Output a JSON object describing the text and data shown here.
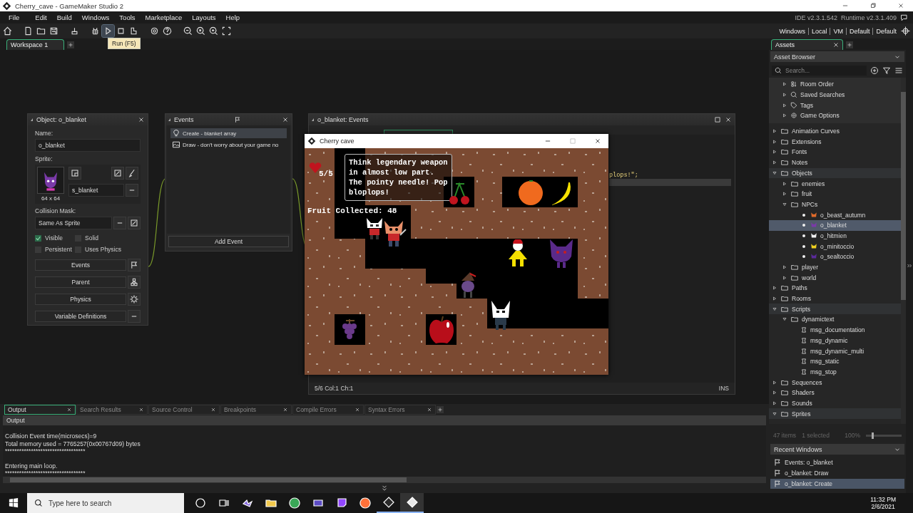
{
  "window": {
    "title": "Cherry_cave - GameMaker Studio 2"
  },
  "menu": [
    "File",
    "Edit",
    "Build",
    "Windows",
    "Tools",
    "Marketplace",
    "Layouts",
    "Help"
  ],
  "ide_version": "IDE v2.3.1.542",
  "runtime_version": "Runtime v2.3.1.409",
  "toolbar": {
    "groups": [
      [
        {
          "kind": "home",
          "active": false
        }
      ],
      [
        {
          "kind": "new",
          "active": false
        },
        {
          "kind": "open",
          "active": false
        },
        {
          "kind": "save",
          "active": false
        }
      ],
      [
        {
          "kind": "clean",
          "active": false
        }
      ],
      [
        {
          "kind": "debug",
          "active": false
        },
        {
          "kind": "run",
          "active": true
        },
        {
          "kind": "stop",
          "active": false
        },
        {
          "kind": "build",
          "active": false
        }
      ],
      [
        {
          "kind": "settings",
          "active": false
        },
        {
          "kind": "help",
          "active": false
        }
      ],
      [
        {
          "kind": "zoomout",
          "active": false
        },
        {
          "kind": "zoomreset",
          "active": false
        },
        {
          "kind": "zoomin",
          "active": false
        },
        {
          "kind": "fullscreen",
          "active": false
        }
      ]
    ],
    "tooltip": "Run (F5)",
    "targets": [
      "Windows",
      "Local",
      "VM",
      "Default",
      "Default"
    ]
  },
  "workspace_tabs": [
    {
      "label": "Workspace 1",
      "selected": true
    }
  ],
  "object_window": {
    "title": "Object: o_blanket",
    "name_label": "Name:",
    "name": "o_blanket",
    "sprite_label": "Sprite:",
    "sprite_size": "64 x 64",
    "sprite": "s_blanket",
    "mask_label": "Collision Mask:",
    "mask": "Same As Sprite",
    "options": [
      {
        "label": "Visible",
        "checked": true
      },
      {
        "label": "Solid",
        "checked": false
      },
      {
        "label": "Persistent",
        "checked": false
      },
      {
        "label": "Uses Physics",
        "checked": false
      }
    ],
    "buttons": [
      {
        "label": "Events",
        "kind": "flag"
      },
      {
        "label": "Parent",
        "kind": "parent"
      },
      {
        "label": "Physics",
        "kind": "gear"
      },
      {
        "label": "Variable Definitions",
        "kind": "more"
      }
    ]
  },
  "events_window": {
    "title": "Events",
    "events": [
      {
        "label": "Create - blanket array",
        "kind": "create",
        "selected": true
      },
      {
        "label": "Draw - don't worry about your game no",
        "kind": "draw",
        "selected": false
      }
    ],
    "add_button": "Add Event"
  },
  "code_window": {
    "title": "o_blanket: Events",
    "code_line": "plops!\";",
    "status": "5/6 Col:1 Ch:1",
    "mode": "INS"
  },
  "game_window": {
    "title": "Cherry cave",
    "health": "5/5",
    "fruit_counter": "Fruit Collected: 48",
    "dialog": "Think legendary weapon in almost low part. The pointy needle! Pop bloplops!"
  },
  "output": {
    "tabs": [
      {
        "label": "Output",
        "selected": true
      },
      {
        "label": "Search Results",
        "selected": false
      },
      {
        "label": "Source Control",
        "selected": false
      },
      {
        "label": "Breakpoints",
        "selected": false
      },
      {
        "label": "Compile Errors",
        "selected": false
      },
      {
        "label": "Syntax Errors",
        "selected": false
      }
    ],
    "header": "Output",
    "blocks": [
      [
        "Collision Event time(microsecs)=9",
        "Total memory used = 7765257(0x00767d09) bytes",
        "**********************************"
      ],
      [
        "Entering main loop.",
        "**********************************"
      ]
    ]
  },
  "assets": {
    "tab": {
      "label": "Assets",
      "selected": true
    },
    "browser": "Asset Browser",
    "search_placeholder": "Search...",
    "specials": [
      {
        "label": "Room Order",
        "kind": "roomorder"
      },
      {
        "label": "Saved Searches",
        "kind": "search"
      },
      {
        "label": "Tags",
        "kind": "tag"
      },
      {
        "label": "Game Options",
        "kind": "gameoptions"
      }
    ],
    "tree": [
      {
        "label": "Animation Curves",
        "kind": "folder",
        "expanded": false,
        "selected": false
      },
      {
        "label": "Extensions",
        "kind": "folder",
        "expanded": false,
        "selected": false
      },
      {
        "label": "Fonts",
        "kind": "folder",
        "expanded": false,
        "selected": false
      },
      {
        "label": "Notes",
        "kind": "folder",
        "expanded": false,
        "selected": false
      },
      {
        "label": "Objects",
        "kind": "folder",
        "expanded": true,
        "selected": false,
        "children": [
          {
            "label": "enemies",
            "kind": "folder",
            "expanded": false,
            "selected": false
          },
          {
            "label": "fruit",
            "kind": "folder",
            "expanded": false,
            "selected": false
          },
          {
            "label": "NPCs",
            "kind": "folder",
            "expanded": true,
            "selected": false,
            "children": [
              {
                "label": "o_beast_autumn",
                "kind": "object",
                "color": "#e06a2a",
                "selected": false
              },
              {
                "label": "o_blanket",
                "kind": "object",
                "color": "#7a3aa8",
                "selected": true
              },
              {
                "label": "o_hitmien",
                "kind": "object",
                "color": "#f0f0f0",
                "selected": false
              },
              {
                "label": "o_minitoccio",
                "kind": "object",
                "color": "#f0d020",
                "selected": false
              },
              {
                "label": "o_sealtoccio",
                "kind": "object",
                "color": "#5a2a9a",
                "selected": false
              }
            ]
          },
          {
            "label": "player",
            "kind": "folder",
            "expanded": false,
            "selected": false
          },
          {
            "label": "world",
            "kind": "folder",
            "expanded": false,
            "selected": false
          }
        ]
      },
      {
        "label": "Paths",
        "kind": "folder",
        "expanded": false,
        "selected": false
      },
      {
        "label": "Rooms",
        "kind": "folder",
        "expanded": false,
        "selected": false
      },
      {
        "label": "Scripts",
        "kind": "folder",
        "expanded": true,
        "selected": false,
        "children": [
          {
            "label": "dynamictext",
            "kind": "folder",
            "expanded": true,
            "selected": false,
            "children": [
              {
                "label": "msg_documentation",
                "kind": "script",
                "selected": false
              },
              {
                "label": "msg_dynamic",
                "kind": "script",
                "selected": false
              },
              {
                "label": "msg_dynamic_multi",
                "kind": "script",
                "selected": false
              },
              {
                "label": "msg_static",
                "kind": "script",
                "selected": false
              },
              {
                "label": "msg_stop",
                "kind": "script",
                "selected": false
              }
            ]
          }
        ]
      },
      {
        "label": "Sequences",
        "kind": "folder",
        "expanded": false,
        "selected": false
      },
      {
        "label": "Shaders",
        "kind": "folder",
        "expanded": false,
        "selected": false
      },
      {
        "label": "Sounds",
        "kind": "folder",
        "expanded": false,
        "selected": false
      },
      {
        "label": "Sprites",
        "kind": "folder",
        "expanded": true,
        "selected": false
      }
    ],
    "count": "47 items",
    "selection": "1 selected",
    "zoom": "100%",
    "zoom_slider": {
      "level": 0.15
    },
    "recent_title": "Recent Windows",
    "recent": [
      {
        "label": "Events: o_blanket",
        "selected": false
      },
      {
        "label": "o_blanket: Draw",
        "selected": false
      },
      {
        "label": "o_blanket: Create",
        "selected": true
      }
    ]
  },
  "taskbar": {
    "search_placeholder": "Type here to search",
    "apps": [
      {
        "kind": "cortana"
      },
      {
        "kind": "taskview"
      },
      {
        "kind": "purple"
      },
      {
        "kind": "files"
      },
      {
        "kind": "chrome"
      },
      {
        "kind": "violet"
      },
      {
        "kind": "twitch"
      },
      {
        "kind": "firefox"
      },
      {
        "kind": "gamemaker"
      },
      {
        "kind": "gamemaker2"
      }
    ],
    "time": "11:32 PM",
    "date": "2/6/2021"
  }
}
